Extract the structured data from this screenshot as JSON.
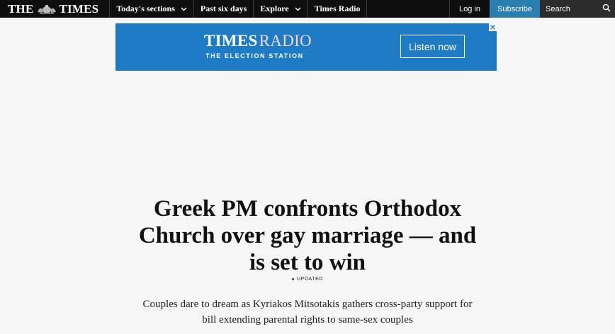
{
  "header": {
    "logo_left": "THE",
    "logo_right": "TIMES",
    "nav": [
      {
        "label": "Today's sections",
        "has_dropdown": true
      },
      {
        "label": "Past six days",
        "has_dropdown": false
      },
      {
        "label": "Explore",
        "has_dropdown": true
      },
      {
        "label": "Times Radio",
        "has_dropdown": false
      }
    ],
    "login_label": "Log in",
    "subscribe_label": "Subscribe",
    "search_placeholder": "Search"
  },
  "ad": {
    "brand_bold": "TIMES",
    "brand_light": "RADIO",
    "tagline": "THE ELECTION STATION",
    "cta_label": "Listen now"
  },
  "article": {
    "headline": "Greek PM confronts Orthodox Church over gay marriage — and is set to win",
    "status": "UPDATED",
    "standfirst": "Couples dare to dream as Kyriakos Mitsotakis gathers cross-party support for bill extending parental rights to same-sex couples"
  },
  "colors": {
    "topbar": "#0e0e0e",
    "subscribe": "#2a7fae",
    "ad_background": "#1f7cc4",
    "page_background": "#f6f6f6"
  }
}
